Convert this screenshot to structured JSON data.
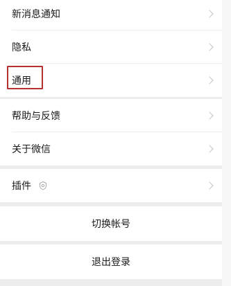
{
  "settings_group_1": {
    "new_message_notification": "新消息通知",
    "privacy": "隐私",
    "general": "通用"
  },
  "settings_group_2": {
    "help_feedback": "帮助与反馈",
    "about_wechat": "关于微信"
  },
  "settings_group_3": {
    "plugins": "插件"
  },
  "account_actions": {
    "switch_account": "切换帐号",
    "logout": "退出登录"
  },
  "icons": {
    "chevron": "chevron-right-icon",
    "plugin_badge": "plugin-icon"
  },
  "colors": {
    "background": "#ededed",
    "row_background": "#ffffff",
    "highlight_box": "#b3312f",
    "text": "#1a1a1a",
    "chevron": "#c4c4c4"
  }
}
